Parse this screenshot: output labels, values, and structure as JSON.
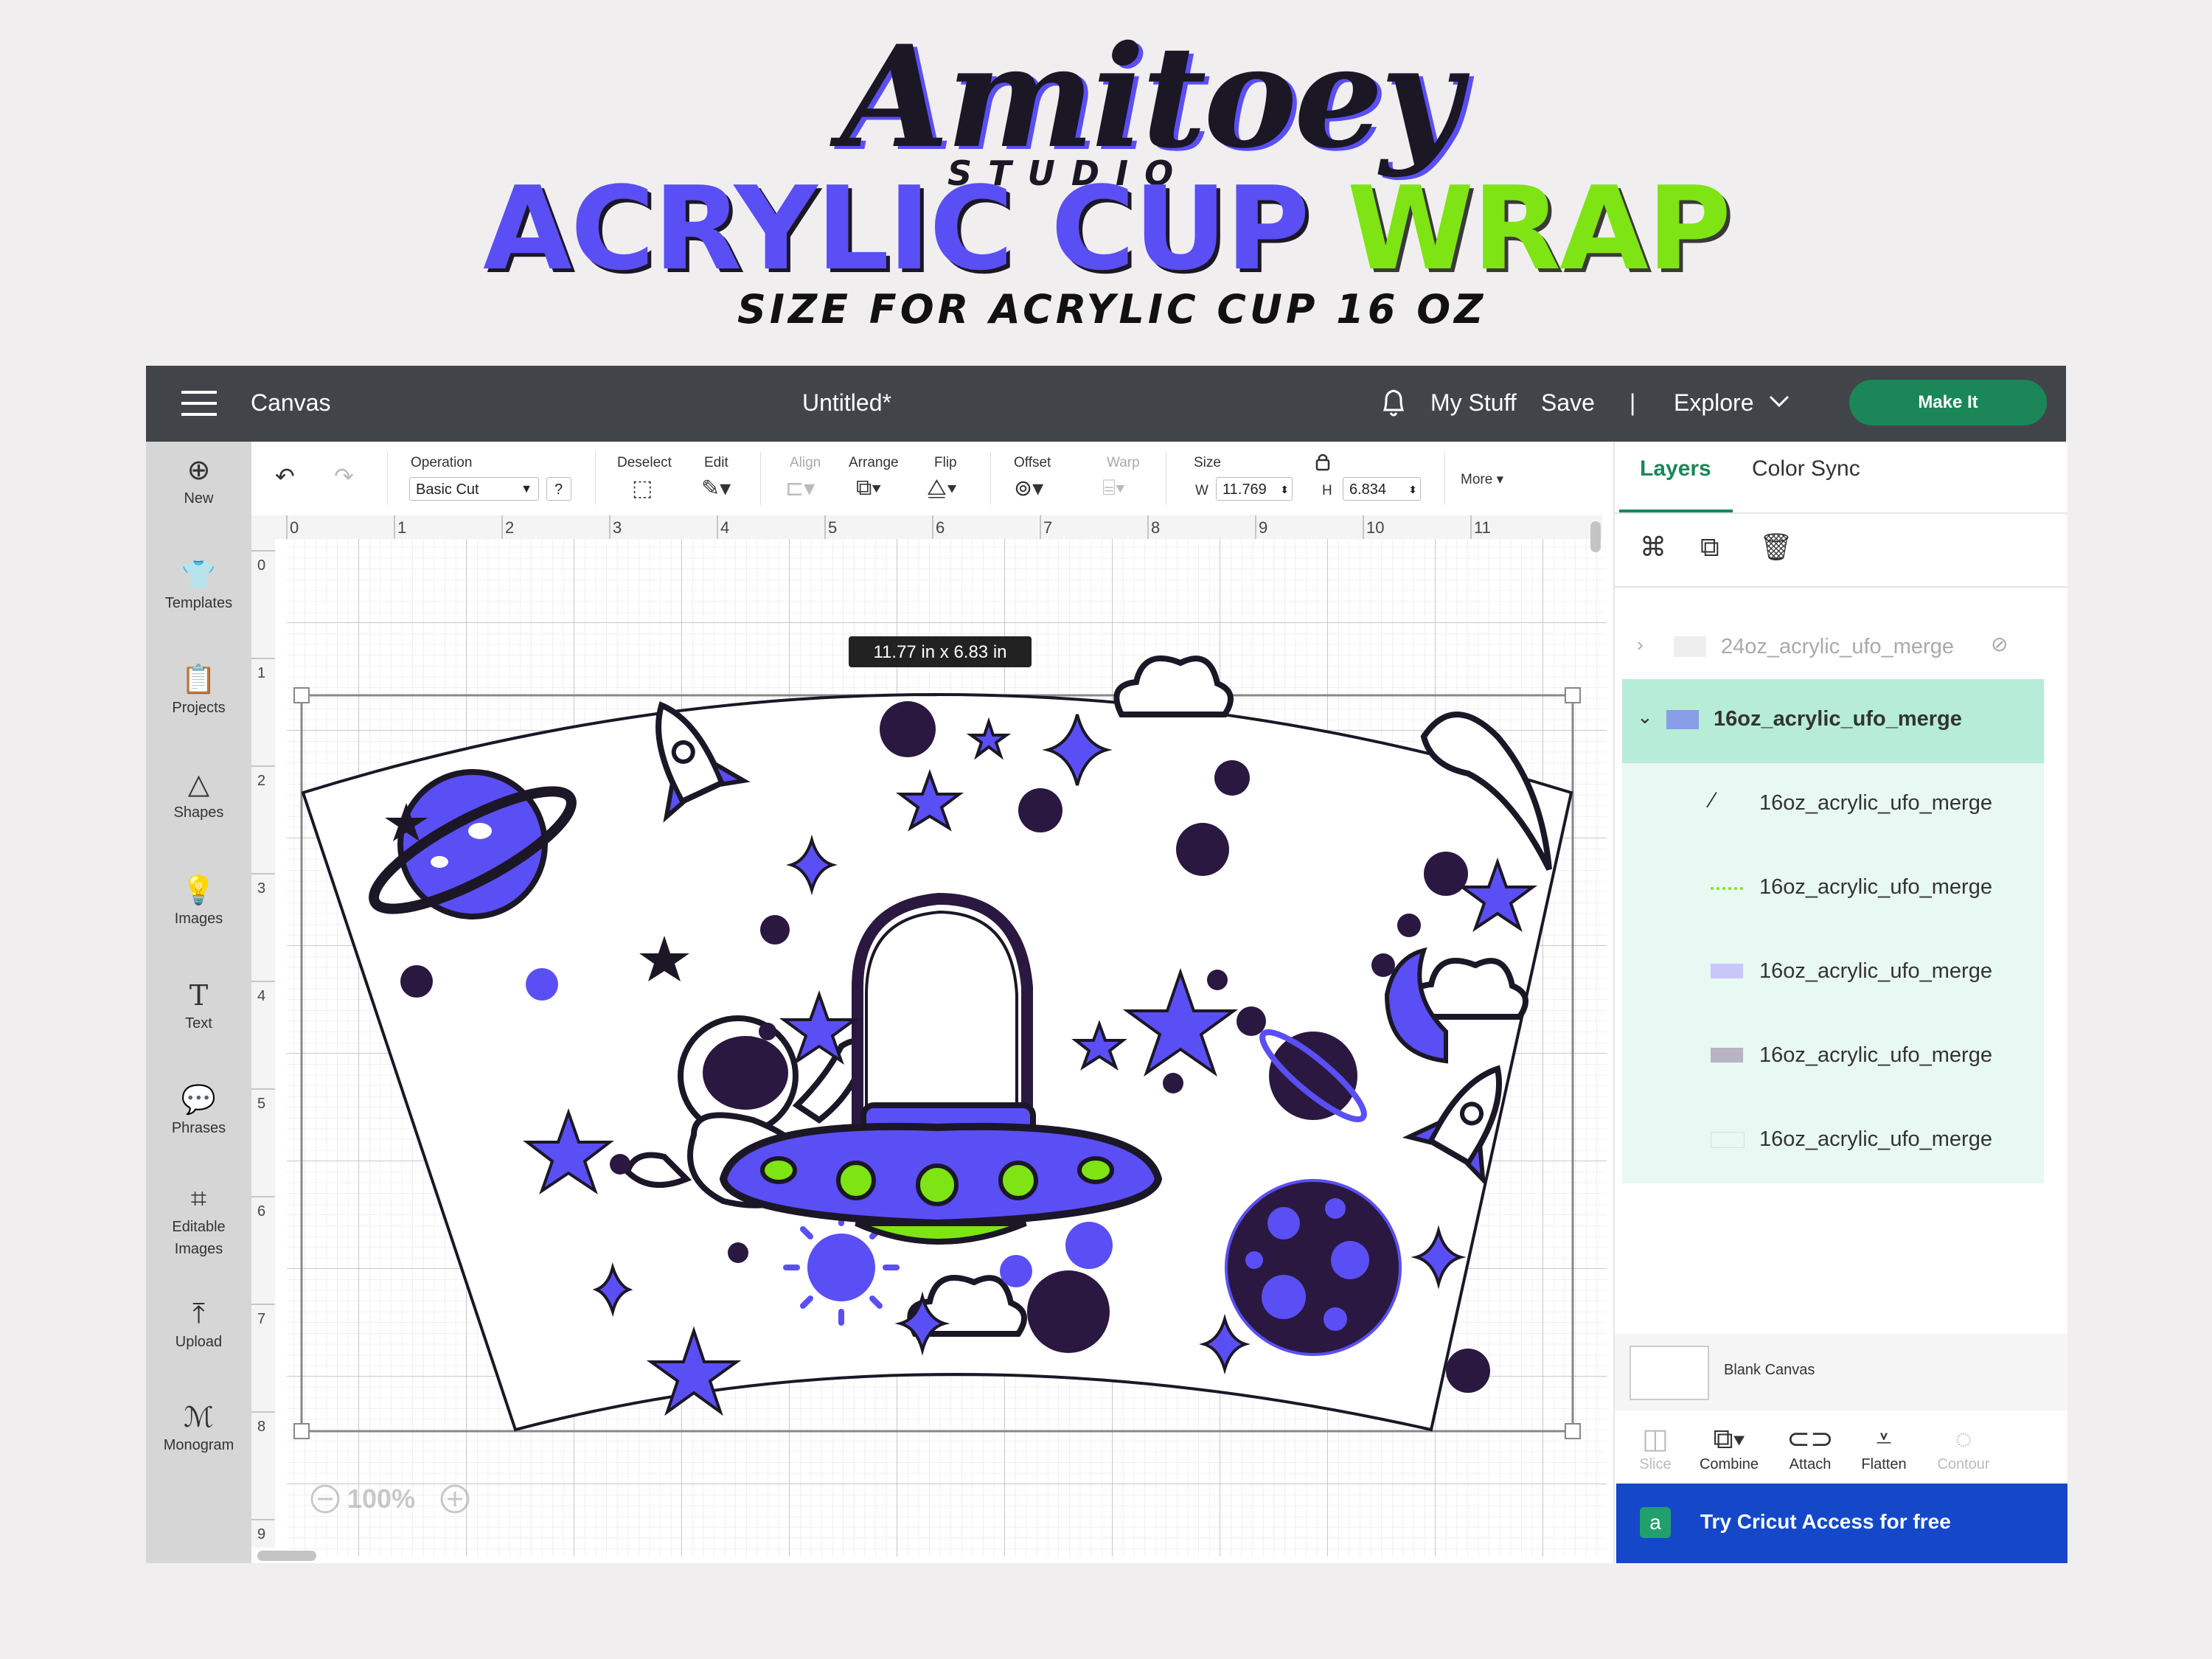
{
  "banner": {
    "brand_script": "Amitoey",
    "brand_sub": "STUDIO",
    "headline_part1": "ACRYLIC CUP",
    "headline_part2": "WRAP",
    "subheadline": "SIZE FOR ACRYLIC CUP 16 OZ"
  },
  "colors": {
    "brand_purple": "#5a4ff4",
    "brand_green": "#7ee414",
    "topbar_bg": "#414549",
    "make_it_green": "#1b8758",
    "selected_layer_bg": "#b7ecd8",
    "access_blue": "#1448c9"
  },
  "topbar": {
    "menu_icon": "hamburger-icon",
    "app_name": "Canvas",
    "doc_title": "Untitled*",
    "bell_icon": "bell-icon",
    "my_stuff": "My Stuff",
    "save": "Save",
    "separator": "|",
    "explore": "Explore",
    "make_it": "Make It"
  },
  "leftnav": [
    {
      "icon": "plus-circle-icon",
      "label": "New"
    },
    {
      "icon": "shirt-icon",
      "label": "Templates"
    },
    {
      "icon": "clipboard-icon",
      "label": "Projects"
    },
    {
      "icon": "shapes-icon",
      "label": "Shapes"
    },
    {
      "icon": "lightbulb-icon",
      "label": "Images"
    },
    {
      "icon": "text-t-icon",
      "label": "Text"
    },
    {
      "icon": "speech-bubble-icon",
      "label": "Phrases"
    },
    {
      "icon": "node-edit-icon",
      "label": "Editable Images"
    },
    {
      "icon": "upload-icon",
      "label": "Upload"
    },
    {
      "icon": "monogram-icon",
      "label": "Monogram"
    }
  ],
  "toolbar": {
    "operation_label": "Operation",
    "operation_value": "Basic Cut",
    "help": "?",
    "deselect": "Deselect",
    "edit": "Edit",
    "align": "Align",
    "arrange": "Arrange",
    "flip": "Flip",
    "offset": "Offset",
    "warp": "Warp",
    "size": "Size",
    "w_label": "W",
    "w_value": "11.769",
    "h_label": "H",
    "h_value": "6.834",
    "more": "More"
  },
  "canvas": {
    "ruler_x": [
      "0",
      "1",
      "2",
      "3",
      "4",
      "5",
      "6",
      "7",
      "8",
      "9",
      "10",
      "11"
    ],
    "ruler_y": [
      "0",
      "1",
      "2",
      "3",
      "4",
      "5",
      "6",
      "7",
      "8",
      "9"
    ],
    "dimension_tooltip": "11.77  in x 6.83  in",
    "zoom": "100%"
  },
  "layers_panel": {
    "tab_layers": "Layers",
    "tab_color_sync": "Color Sync",
    "hidden_layer": "24oz_acrylic_ufo_merge",
    "group_layer": "16oz_acrylic_ufo_merge",
    "children": [
      "16oz_acrylic_ufo_merge",
      "16oz_acrylic_ufo_merge",
      "16oz_acrylic_ufo_merge",
      "16oz_acrylic_ufo_merge",
      "16oz_acrylic_ufo_merge"
    ],
    "blank_canvas": "Blank Canvas",
    "ribbon": [
      "Slice",
      "Combine",
      "Attach",
      "Flatten",
      "Contour"
    ],
    "access_cta": "Try Cricut Access for free"
  }
}
